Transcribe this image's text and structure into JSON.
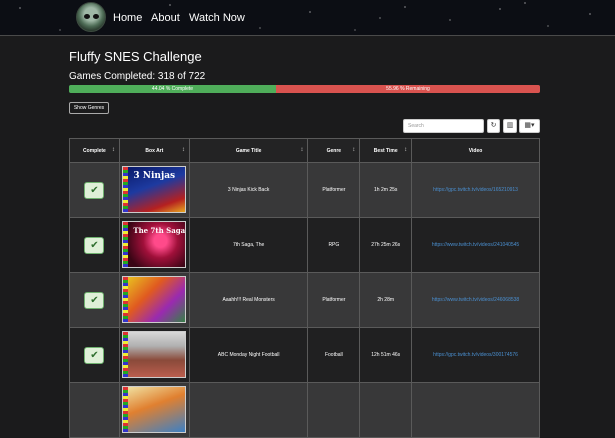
{
  "nav": {
    "links": [
      "Home",
      "About",
      "Watch Now"
    ]
  },
  "page": {
    "title": "Fluffy SNES Challenge",
    "progress_label": "Games Completed: 318 of 722",
    "progress_complete_text": "44.04 % Complete",
    "progress_remaining_text": "55.96 % Remaining",
    "progress_complete_fraction": 0.4404,
    "show_genres_label": "Show Genres"
  },
  "toolbar": {
    "search_placeholder": "Search",
    "refresh_icon": "refresh-icon",
    "columns_icon": "columns-icon",
    "grid_icon": "grid-icon"
  },
  "colors": {
    "complete": "#4fae5a",
    "remaining": "#d9534f",
    "link": "#4a8fd0"
  },
  "table": {
    "headers": [
      "Complete",
      "Box Art",
      "Game Title",
      "Genre",
      "Best Time",
      "Video"
    ],
    "rows": [
      {
        "title": "3 Ninjas Kick Back",
        "genre": "Platformer",
        "time": "1h 2m 25s",
        "video": "https://gpc.twitch.tv/videos/165210913",
        "art": "ninjas",
        "art_text": "3 Ninjas"
      },
      {
        "title": "7th Saga, The",
        "genre": "RPG",
        "time": "27h 25m 26s",
        "video": "https://www.twitch.tv/videos/241040545",
        "art": "saga",
        "art_text": "The 7th Saga"
      },
      {
        "title": "Aaahh!!! Real Monsters",
        "genre": "Platformer",
        "time": "2h 28m",
        "video": "https://www.twitch.tv/videos/246068538",
        "art": "monsters",
        "art_text": ""
      },
      {
        "title": "ABC Monday Night Football",
        "genre": "Football",
        "time": "12h 51m 46s",
        "video": "https://gpc.twitch.tv/videos/300174576",
        "art": "football",
        "art_text": ""
      }
    ]
  }
}
